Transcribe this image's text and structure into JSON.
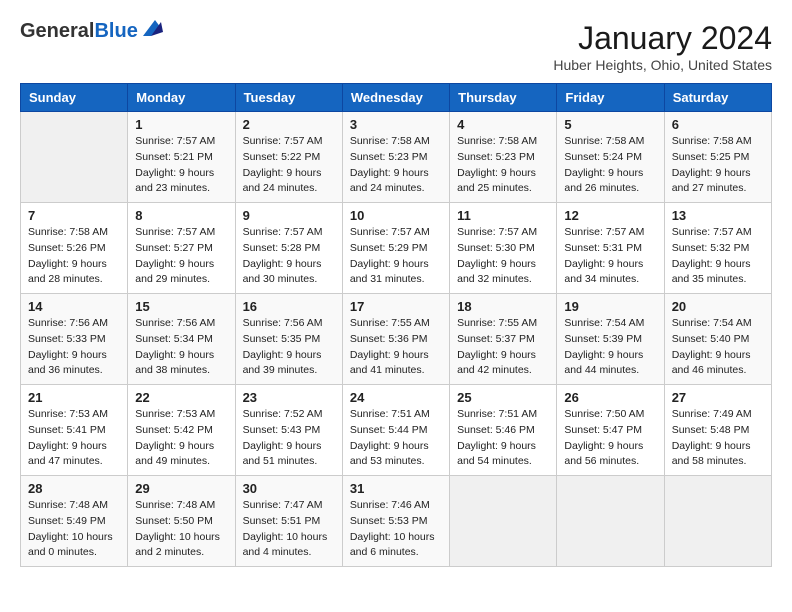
{
  "header": {
    "logo_general": "General",
    "logo_blue": "Blue",
    "title": "January 2024",
    "subtitle": "Huber Heights, Ohio, United States"
  },
  "weekdays": [
    "Sunday",
    "Monday",
    "Tuesday",
    "Wednesday",
    "Thursday",
    "Friday",
    "Saturday"
  ],
  "weeks": [
    [
      {
        "day": "",
        "sunrise": "",
        "sunset": "",
        "daylight": ""
      },
      {
        "day": "1",
        "sunrise": "Sunrise: 7:57 AM",
        "sunset": "Sunset: 5:21 PM",
        "daylight": "Daylight: 9 hours and 23 minutes."
      },
      {
        "day": "2",
        "sunrise": "Sunrise: 7:57 AM",
        "sunset": "Sunset: 5:22 PM",
        "daylight": "Daylight: 9 hours and 24 minutes."
      },
      {
        "day": "3",
        "sunrise": "Sunrise: 7:58 AM",
        "sunset": "Sunset: 5:23 PM",
        "daylight": "Daylight: 9 hours and 24 minutes."
      },
      {
        "day": "4",
        "sunrise": "Sunrise: 7:58 AM",
        "sunset": "Sunset: 5:23 PM",
        "daylight": "Daylight: 9 hours and 25 minutes."
      },
      {
        "day": "5",
        "sunrise": "Sunrise: 7:58 AM",
        "sunset": "Sunset: 5:24 PM",
        "daylight": "Daylight: 9 hours and 26 minutes."
      },
      {
        "day": "6",
        "sunrise": "Sunrise: 7:58 AM",
        "sunset": "Sunset: 5:25 PM",
        "daylight": "Daylight: 9 hours and 27 minutes."
      }
    ],
    [
      {
        "day": "7",
        "sunrise": "Sunrise: 7:58 AM",
        "sunset": "Sunset: 5:26 PM",
        "daylight": "Daylight: 9 hours and 28 minutes."
      },
      {
        "day": "8",
        "sunrise": "Sunrise: 7:57 AM",
        "sunset": "Sunset: 5:27 PM",
        "daylight": "Daylight: 9 hours and 29 minutes."
      },
      {
        "day": "9",
        "sunrise": "Sunrise: 7:57 AM",
        "sunset": "Sunset: 5:28 PM",
        "daylight": "Daylight: 9 hours and 30 minutes."
      },
      {
        "day": "10",
        "sunrise": "Sunrise: 7:57 AM",
        "sunset": "Sunset: 5:29 PM",
        "daylight": "Daylight: 9 hours and 31 minutes."
      },
      {
        "day": "11",
        "sunrise": "Sunrise: 7:57 AM",
        "sunset": "Sunset: 5:30 PM",
        "daylight": "Daylight: 9 hours and 32 minutes."
      },
      {
        "day": "12",
        "sunrise": "Sunrise: 7:57 AM",
        "sunset": "Sunset: 5:31 PM",
        "daylight": "Daylight: 9 hours and 34 minutes."
      },
      {
        "day": "13",
        "sunrise": "Sunrise: 7:57 AM",
        "sunset": "Sunset: 5:32 PM",
        "daylight": "Daylight: 9 hours and 35 minutes."
      }
    ],
    [
      {
        "day": "14",
        "sunrise": "Sunrise: 7:56 AM",
        "sunset": "Sunset: 5:33 PM",
        "daylight": "Daylight: 9 hours and 36 minutes."
      },
      {
        "day": "15",
        "sunrise": "Sunrise: 7:56 AM",
        "sunset": "Sunset: 5:34 PM",
        "daylight": "Daylight: 9 hours and 38 minutes."
      },
      {
        "day": "16",
        "sunrise": "Sunrise: 7:56 AM",
        "sunset": "Sunset: 5:35 PM",
        "daylight": "Daylight: 9 hours and 39 minutes."
      },
      {
        "day": "17",
        "sunrise": "Sunrise: 7:55 AM",
        "sunset": "Sunset: 5:36 PM",
        "daylight": "Daylight: 9 hours and 41 minutes."
      },
      {
        "day": "18",
        "sunrise": "Sunrise: 7:55 AM",
        "sunset": "Sunset: 5:37 PM",
        "daylight": "Daylight: 9 hours and 42 minutes."
      },
      {
        "day": "19",
        "sunrise": "Sunrise: 7:54 AM",
        "sunset": "Sunset: 5:39 PM",
        "daylight": "Daylight: 9 hours and 44 minutes."
      },
      {
        "day": "20",
        "sunrise": "Sunrise: 7:54 AM",
        "sunset": "Sunset: 5:40 PM",
        "daylight": "Daylight: 9 hours and 46 minutes."
      }
    ],
    [
      {
        "day": "21",
        "sunrise": "Sunrise: 7:53 AM",
        "sunset": "Sunset: 5:41 PM",
        "daylight": "Daylight: 9 hours and 47 minutes."
      },
      {
        "day": "22",
        "sunrise": "Sunrise: 7:53 AM",
        "sunset": "Sunset: 5:42 PM",
        "daylight": "Daylight: 9 hours and 49 minutes."
      },
      {
        "day": "23",
        "sunrise": "Sunrise: 7:52 AM",
        "sunset": "Sunset: 5:43 PM",
        "daylight": "Daylight: 9 hours and 51 minutes."
      },
      {
        "day": "24",
        "sunrise": "Sunrise: 7:51 AM",
        "sunset": "Sunset: 5:44 PM",
        "daylight": "Daylight: 9 hours and 53 minutes."
      },
      {
        "day": "25",
        "sunrise": "Sunrise: 7:51 AM",
        "sunset": "Sunset: 5:46 PM",
        "daylight": "Daylight: 9 hours and 54 minutes."
      },
      {
        "day": "26",
        "sunrise": "Sunrise: 7:50 AM",
        "sunset": "Sunset: 5:47 PM",
        "daylight": "Daylight: 9 hours and 56 minutes."
      },
      {
        "day": "27",
        "sunrise": "Sunrise: 7:49 AM",
        "sunset": "Sunset: 5:48 PM",
        "daylight": "Daylight: 9 hours and 58 minutes."
      }
    ],
    [
      {
        "day": "28",
        "sunrise": "Sunrise: 7:48 AM",
        "sunset": "Sunset: 5:49 PM",
        "daylight": "Daylight: 10 hours and 0 minutes."
      },
      {
        "day": "29",
        "sunrise": "Sunrise: 7:48 AM",
        "sunset": "Sunset: 5:50 PM",
        "daylight": "Daylight: 10 hours and 2 minutes."
      },
      {
        "day": "30",
        "sunrise": "Sunrise: 7:47 AM",
        "sunset": "Sunset: 5:51 PM",
        "daylight": "Daylight: 10 hours and 4 minutes."
      },
      {
        "day": "31",
        "sunrise": "Sunrise: 7:46 AM",
        "sunset": "Sunset: 5:53 PM",
        "daylight": "Daylight: 10 hours and 6 minutes."
      },
      {
        "day": "",
        "sunrise": "",
        "sunset": "",
        "daylight": ""
      },
      {
        "day": "",
        "sunrise": "",
        "sunset": "",
        "daylight": ""
      },
      {
        "day": "",
        "sunrise": "",
        "sunset": "",
        "daylight": ""
      }
    ]
  ]
}
